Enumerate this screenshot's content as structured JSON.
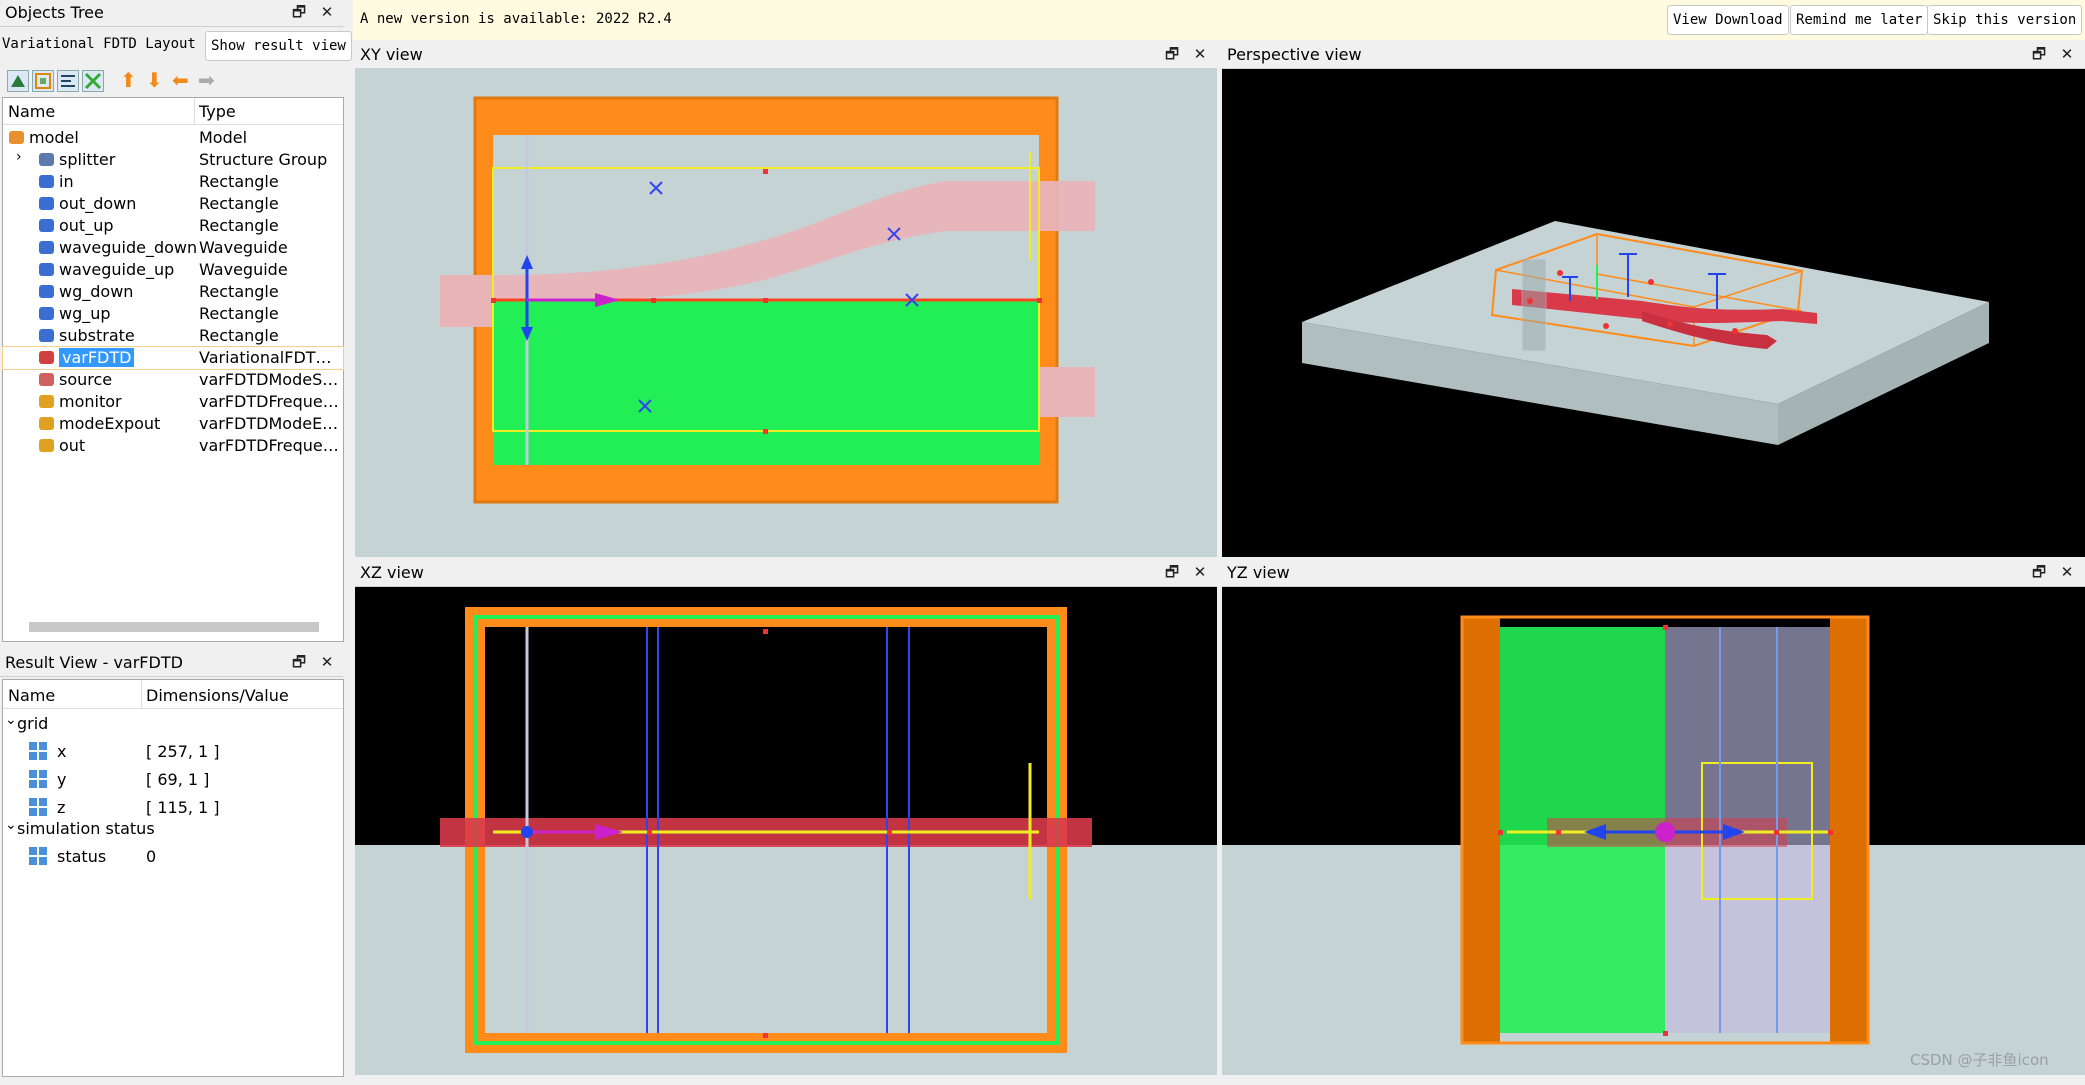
{
  "objects_tree": {
    "title": "Objects Tree",
    "layout_label": "Variational FDTD Layout",
    "show_result_button": "Show result view",
    "col_name": "Name",
    "col_type": "Type",
    "items": [
      {
        "name": "model",
        "type": "Model"
      },
      {
        "name": "splitter",
        "type": "Structure Group"
      },
      {
        "name": "in",
        "type": "Rectangle"
      },
      {
        "name": "out_down",
        "type": "Rectangle"
      },
      {
        "name": "out_up",
        "type": "Rectangle"
      },
      {
        "name": "waveguide_down",
        "type": "Waveguide"
      },
      {
        "name": "waveguide_up",
        "type": "Waveguide"
      },
      {
        "name": "wg_down",
        "type": "Rectangle"
      },
      {
        "name": "wg_up",
        "type": "Rectangle"
      },
      {
        "name": "substrate",
        "type": "Rectangle"
      },
      {
        "name": "varFDTD",
        "type": "VariationalFDTDS..."
      },
      {
        "name": "source",
        "type": "varFDTDModeSo..."
      },
      {
        "name": "monitor",
        "type": "varFDTDFrequenc..."
      },
      {
        "name": "modeExpout",
        "type": "varFDTDModeExp..."
      },
      {
        "name": "out",
        "type": "varFDTDFrequenc..."
      }
    ]
  },
  "result_view": {
    "title": "Result View - varFDTD",
    "col_name": "Name",
    "col_value": "Dimensions/Value",
    "grid_label": "grid",
    "grid_items": [
      {
        "name": "x",
        "value": "[ 257, 1 ]"
      },
      {
        "name": "y",
        "value": "[ 69, 1 ]"
      },
      {
        "name": "z",
        "value": "[ 115, 1 ]"
      }
    ],
    "sim_label": "simulation status",
    "sim_items": [
      {
        "name": "status",
        "value": "0"
      }
    ]
  },
  "update_bar": {
    "message": "A new version is available: 2022 R2.4",
    "view_download": "View Download",
    "remind_later": "Remind me later",
    "skip_version": "Skip this version"
  },
  "views": {
    "xy": "XY view",
    "perspective": "Perspective view",
    "xz": "XZ view",
    "yz": "YZ view"
  },
  "watermark": "CSDN @子非鱼icon",
  "colors": {
    "view_bg": "#c5d3d5",
    "fdtd_orange": "#ff8c1a",
    "waveguide_pink": "#e8b4b8",
    "green": "#22ee55",
    "selected": "#3399ff"
  }
}
